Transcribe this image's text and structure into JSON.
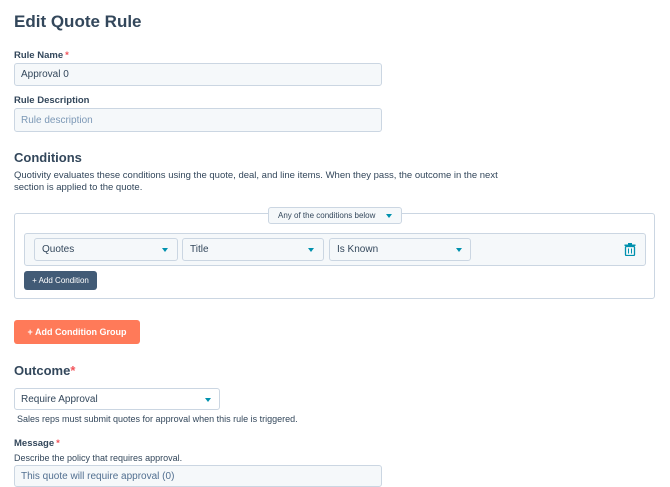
{
  "page": {
    "title": "Edit Quote Rule"
  },
  "rule_name": {
    "label": "Rule Name",
    "required_mark": "*",
    "value": "Approval 0"
  },
  "rule_description": {
    "label": "Rule Description",
    "placeholder": "Rule description"
  },
  "conditions": {
    "heading": "Conditions",
    "description_line1": "Quotivity evaluates these conditions using the quote, deal, and line items. When they pass, the outcome in the next",
    "description_line2": "section is applied to the quote.",
    "group_match": "Any of the conditions below",
    "row": {
      "object": "Quotes",
      "property": "Title",
      "operator": "Is Known"
    },
    "add_condition_label": "+ Add Condition",
    "add_group_label": "+ Add Condition Group"
  },
  "outcome": {
    "heading": "Outcome",
    "required_mark": "*",
    "value": "Require Approval",
    "help": "Sales reps must submit quotes for approval when this rule is triggered."
  },
  "message": {
    "label": "Message",
    "required_mark": "*",
    "help": "Describe the policy that requires approval.",
    "value": "This quote will require approval (0)"
  },
  "colors": {
    "primary_text": "#33475b",
    "accent_teal": "#0091ae",
    "orange": "#ff7a59",
    "dark_button": "#425b76"
  }
}
